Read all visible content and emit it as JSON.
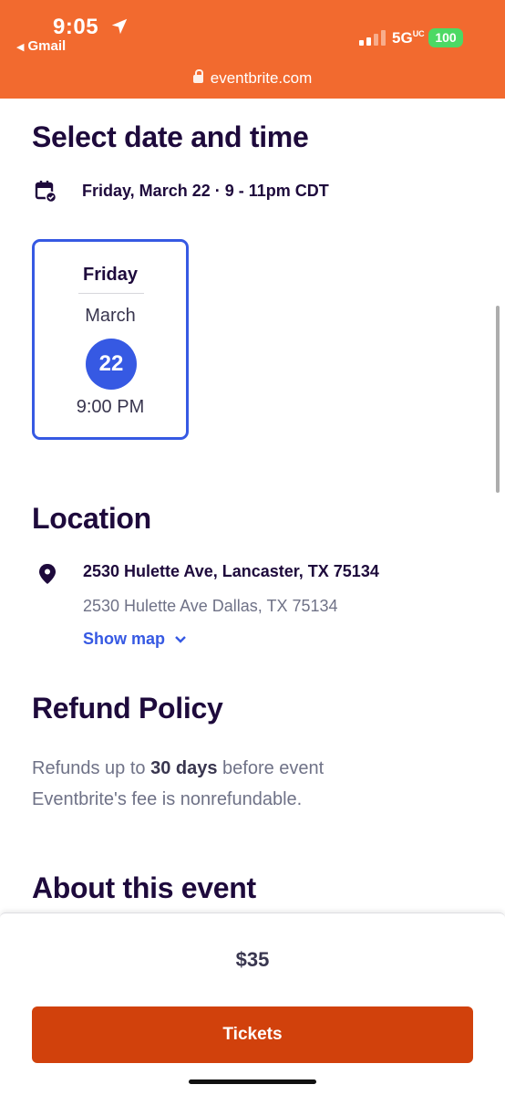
{
  "status_bar": {
    "time": "9:05",
    "back_app": "Gmail",
    "network": "5G",
    "network_suffix": "UC",
    "battery": "100",
    "url": "eventbrite.com"
  },
  "sections": {
    "date_heading": "Select date and time",
    "date_summary": "Friday, March 22 · 9 - 11pm CDT",
    "location_heading": "Location",
    "refund_heading": "Refund Policy",
    "about_heading": "About this event"
  },
  "date_card": {
    "weekday": "Friday",
    "month": "March",
    "day": "22",
    "time": "9:00 PM"
  },
  "location": {
    "title": "2530 Hulette Ave, Lancaster, TX 75134",
    "subtitle": "2530 Hulette Ave Dallas, TX 75134",
    "show_map": "Show map"
  },
  "refund": {
    "prefix": "Refunds up to ",
    "bold": "30 days",
    "suffix": " before event",
    "line2": "Eventbrite's fee is nonrefundable."
  },
  "footer": {
    "price": "$35",
    "button": "Tickets"
  },
  "colors": {
    "topbar": "#f26a2f",
    "accent_blue": "#3659e3",
    "cta": "#d1410c",
    "heading": "#1e0a3c"
  }
}
